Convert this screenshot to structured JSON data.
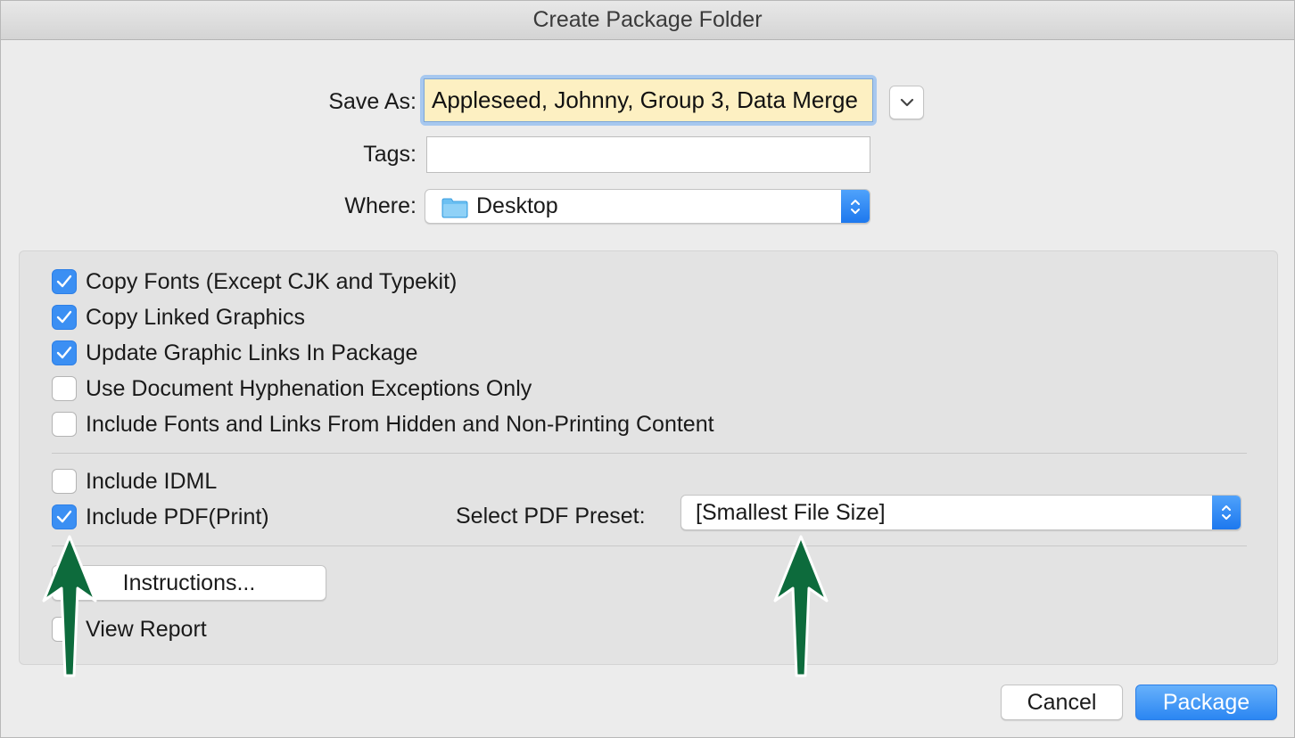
{
  "window": {
    "title": "Create Package Folder"
  },
  "form": {
    "save_as_label": "Save As:",
    "save_as_value": "Appleseed, Johnny, Group 3, Data Merge",
    "tags_label": "Tags:",
    "tags_value": "",
    "where_label": "Where:",
    "where_value": "Desktop"
  },
  "options": {
    "copy_fonts": {
      "label": "Copy Fonts (Except CJK and Typekit)",
      "checked": true
    },
    "copy_linked_graphics": {
      "label": "Copy Linked Graphics",
      "checked": true
    },
    "update_graphic_links": {
      "label": "Update Graphic Links In Package",
      "checked": true
    },
    "use_hyphenation_exceptions": {
      "label": "Use Document Hyphenation Exceptions Only",
      "checked": false
    },
    "include_hidden_content": {
      "label": "Include Fonts and Links From Hidden and Non-Printing Content",
      "checked": false
    },
    "include_idml": {
      "label": "Include IDML",
      "checked": false
    },
    "include_pdf": {
      "label": "Include PDF(Print)",
      "checked": true
    },
    "view_report": {
      "label": "View Report",
      "checked": false
    }
  },
  "pdf_preset": {
    "label": "Select PDF Preset:",
    "value": "[Smallest File Size]"
  },
  "buttons": {
    "instructions": "Instructions...",
    "cancel": "Cancel",
    "package": "Package"
  },
  "colors": {
    "accent": "#3b8ff3",
    "save_as_highlight": "#fdf0c2",
    "annotation_arrow": "#0d6b3c"
  },
  "icons": {
    "save_as_expand": "chevron-down-icon",
    "where_folder": "folder-icon",
    "popup_stepper": "up-down-chevron-icon",
    "checkmark": "checkmark-icon",
    "annotation": "up-arrow-icon"
  }
}
